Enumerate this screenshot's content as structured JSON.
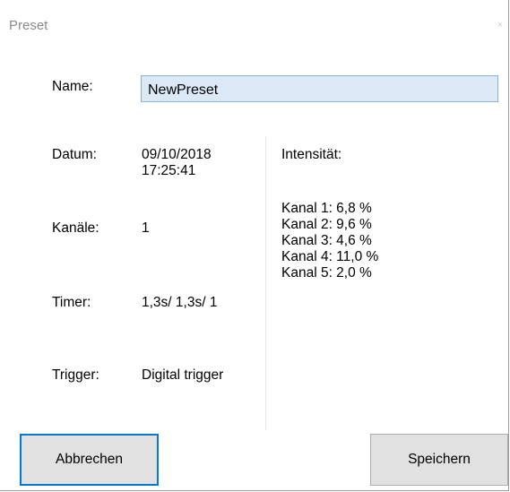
{
  "window": {
    "title": "Preset",
    "close_label": "×"
  },
  "form": {
    "name_label": "Name:",
    "name_value": "NewPreset",
    "date_label": "Datum:",
    "date_value_line1": "09/10/2018",
    "date_value_line2": "17:25:41",
    "channels_label": "Kanäle:",
    "channels_value": "1",
    "timer_label": "Timer:",
    "timer_value": "1,3s/ 1,3s/ 1",
    "trigger_label": "Trigger:",
    "trigger_value": "Digital trigger"
  },
  "intensity": {
    "title": "Intensität:",
    "channels": [
      "Kanal 1: 6,8 %",
      "Kanal 2: 9,6 %",
      "Kanal 3: 4,6 %",
      "Kanal 4: 11,0 %",
      "Kanal 5: 2,0 %"
    ]
  },
  "buttons": {
    "cancel_label": "Abbrechen",
    "save_label": "Speichern"
  },
  "colors": {
    "focus_border": "#0078d7",
    "input_background": "#dbe8f5",
    "button_background": "#e1e1e1"
  }
}
